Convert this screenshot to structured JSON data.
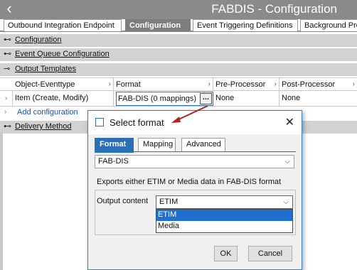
{
  "window": {
    "title": "FABDIS - Configuration",
    "back_glyph": "‹"
  },
  "tabs": [
    {
      "label": "Outbound Integration Endpoint",
      "active": false
    },
    {
      "label": "Configuration",
      "active": true
    },
    {
      "label": "Event Triggering Definitions",
      "active": false
    },
    {
      "label": "Background Pro",
      "active": false
    }
  ],
  "sections": {
    "configuration": {
      "label": "Configuration",
      "pin": "⊷"
    },
    "event_queue": {
      "label": "Event Queue Configuration",
      "pin": "⊷"
    },
    "output_templates": {
      "label": "Output Templates",
      "pin": "⊸"
    },
    "delivery": {
      "label": "Delivery Method",
      "pin": "⊷"
    }
  },
  "grid": {
    "columns": [
      "Object-Eventtype",
      "Format",
      "Pre-Processor",
      "Post-Processor"
    ],
    "header_arrow": "›",
    "row": {
      "marker": "›",
      "object_eventtype": "Item (Create, Modify)",
      "format": "FAB-DIS (0 mappings)",
      "format_button": "...",
      "pre_processor": "None",
      "post_processor": "None"
    },
    "add_marker": "›",
    "add_label": "Add configuration"
  },
  "dialog": {
    "title": "Select format",
    "close_glyph": "✕",
    "tabs": [
      {
        "label": "Format",
        "active": true
      },
      {
        "label": "Mapping",
        "active": false
      },
      {
        "label": "Advanced",
        "active": false
      }
    ],
    "format_select": {
      "value": "FAB-DIS",
      "chevron": "⌵"
    },
    "description": "Exports either ETIM or Media data in FAB-DIS format",
    "output_content": {
      "label": "Output content",
      "value": "ETIM",
      "chevron": "⌵",
      "options": [
        "ETIM",
        "Media"
      ],
      "selected_index": 0
    },
    "ok_label": "OK",
    "cancel_label": "Cancel"
  },
  "colors": {
    "accent": "#2b6fb6",
    "selection": "#1f6fd1",
    "titlebar": "#8a8a8a",
    "section": "#d2d2d2",
    "annotation_arrow": "#b02020"
  }
}
